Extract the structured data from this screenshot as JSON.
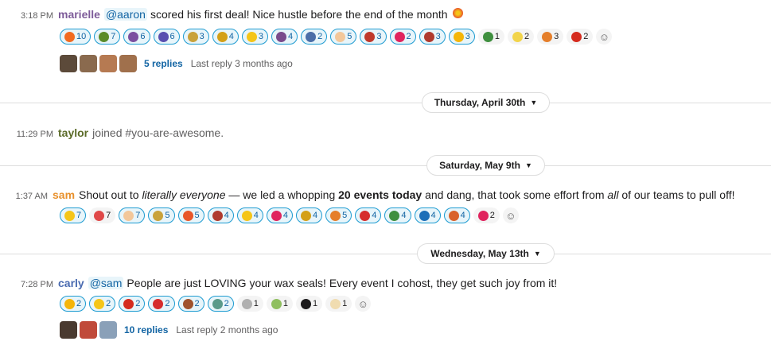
{
  "messages": [
    {
      "time": "3:18 PM",
      "author": "marielle",
      "author_color": "#7d5b99",
      "mention": "@aaron",
      "text": "scored his first deal! Nice hustle before the end of the month",
      "reactions": [
        {
          "count": "10",
          "icon": "fire-icon",
          "color": "#f26b21",
          "on": true
        },
        {
          "count": "7",
          "icon": "turtle-icon",
          "color": "#5b8c2a",
          "on": true
        },
        {
          "count": "6",
          "icon": "family-icon",
          "color": "#7b4fa0",
          "on": true
        },
        {
          "count": "6",
          "icon": "dancer-icon",
          "color": "#5a4fb0",
          "on": true
        },
        {
          "count": "3",
          "icon": "money-bag-icon",
          "color": "#c9a23a",
          "on": true
        },
        {
          "count": "4",
          "icon": "trophy-icon",
          "color": "#d4a017",
          "on": true
        },
        {
          "count": "3",
          "icon": "sunglasses-icon",
          "color": "#f5c518",
          "on": true
        },
        {
          "count": "4",
          "icon": "sculpture-icon",
          "color": "#7a4b8c",
          "on": true
        },
        {
          "count": "2",
          "icon": "golfer-icon",
          "color": "#4b6ea8",
          "on": true
        },
        {
          "count": "5",
          "icon": "clap-icon",
          "color": "#f3c79a",
          "on": true
        },
        {
          "count": "3",
          "icon": "skull-icon",
          "color": "#c0392b",
          "on": true
        },
        {
          "count": "2",
          "icon": "hundred-icon",
          "color": "#e0245e",
          "on": true
        },
        {
          "count": "3",
          "icon": "viking-icon",
          "color": "#b03a2e",
          "on": true
        },
        {
          "count": "3",
          "icon": "sun-icon",
          "color": "#f5b50a",
          "on": true
        },
        {
          "count": "1",
          "icon": "cactus-icon",
          "color": "#3f8f3f",
          "on": false
        },
        {
          "count": "2",
          "icon": "sparkles-icon",
          "color": "#f2d44a",
          "on": false
        },
        {
          "count": "3",
          "icon": "party-popper-icon",
          "color": "#e57f2b",
          "on": false
        },
        {
          "count": "2",
          "icon": "canada-flag-icon",
          "color": "#d52b1e",
          "on": false
        }
      ],
      "thread": {
        "replies": "5 replies",
        "last": "Last reply 3 months ago",
        "avatars": [
          "#5c4a3a",
          "#8a6a4e",
          "#b67a52",
          "#a0704c"
        ]
      }
    },
    {
      "time": "11:29 PM",
      "author": "taylor",
      "author_color": "#5b6b28",
      "system_text": "joined #you-are-awesome."
    },
    {
      "time": "1:37 AM",
      "author": "sam",
      "author_color": "#e8912d",
      "text_parts": [
        "Shout out to ",
        "literally everyone",
        " — we led a whopping ",
        "20 events today",
        " and dang, that took some effort from ",
        "all",
        " of our teams to pull off!"
      ],
      "reactions": [
        {
          "count": "7",
          "icon": "astonished-icon",
          "color": "#f5c518",
          "on": true
        },
        {
          "count": "7",
          "icon": "heart-eyes-icon",
          "color": "#e04848",
          "on": false
        },
        {
          "count": "7",
          "icon": "clap-icon",
          "color": "#f3c79a",
          "on": true
        },
        {
          "count": "5",
          "icon": "money-bag-icon",
          "color": "#c9a23a",
          "on": true
        },
        {
          "count": "5",
          "icon": "boom-icon",
          "color": "#e8562a",
          "on": true
        },
        {
          "count": "4",
          "icon": "viking-icon",
          "color": "#b03a2e",
          "on": true
        },
        {
          "count": "4",
          "icon": "raised-hands-icon",
          "color": "#f5c518",
          "on": true
        },
        {
          "count": "4",
          "icon": "hundred-icon",
          "color": "#e0245e",
          "on": true
        },
        {
          "count": "4",
          "icon": "trophy-icon",
          "color": "#d4a017",
          "on": true
        },
        {
          "count": "5",
          "icon": "party-popper-icon",
          "color": "#e57f2b",
          "on": true
        },
        {
          "count": "4",
          "icon": "pokeball-icon",
          "color": "#d62d2d",
          "on": true
        },
        {
          "count": "4",
          "icon": "cactus-icon",
          "color": "#3f8f3f",
          "on": true
        },
        {
          "count": "4",
          "icon": "wave-logo-icon",
          "color": "#1d6fb8",
          "on": true
        },
        {
          "count": "4",
          "icon": "cake-icon",
          "color": "#d9622b",
          "on": true
        },
        {
          "count": "2",
          "icon": "hundred-icon",
          "color": "#e0245e",
          "on": false
        }
      ]
    },
    {
      "time": "7:28 PM",
      "author": "carly",
      "author_color": "#4a6bb0",
      "mention": "@sam",
      "text": "People are just LOVING your wax seals! Every event I cohost, they get such joy from it!",
      "reactions": [
        {
          "count": "2",
          "icon": "sun-icon",
          "color": "#f5b50a",
          "on": true
        },
        {
          "count": "2",
          "icon": "raised-hands-icon",
          "color": "#f5c518",
          "on": true
        },
        {
          "count": "2",
          "icon": "canada-flag-icon",
          "color": "#d52b1e",
          "on": true
        },
        {
          "count": "2",
          "icon": "pokeball-icon",
          "color": "#d62d2d",
          "on": true
        },
        {
          "count": "2",
          "icon": "donut-icon",
          "color": "#a0522d",
          "on": true
        },
        {
          "count": "2",
          "icon": "bowl-icon",
          "color": "#5a9a8a",
          "on": true
        },
        {
          "count": "1",
          "icon": "envelope-icon",
          "color": "#b0b0b0",
          "on": false
        },
        {
          "count": "1",
          "icon": "fairy-icon",
          "color": "#8fbf5f",
          "on": false
        },
        {
          "count": "1",
          "icon": "smile-outline-icon",
          "color": "#1d1c1d",
          "on": false
        },
        {
          "count": "1",
          "icon": "dumpling-icon",
          "color": "#f0dcb0",
          "on": false
        }
      ],
      "thread": {
        "replies": "10 replies",
        "last": "Last reply 2 months ago",
        "avatars": [
          "#4a3a30",
          "#c04a3a",
          "#8aa0b8"
        ]
      }
    }
  ],
  "dates": {
    "d1": "Thursday, April 30th",
    "d2": "Saturday, May 9th",
    "d3": "Wednesday, May 13th"
  },
  "emoji": {
    "boom": "#e8562a"
  },
  "add_reaction_icon": "add-reaction-icon"
}
